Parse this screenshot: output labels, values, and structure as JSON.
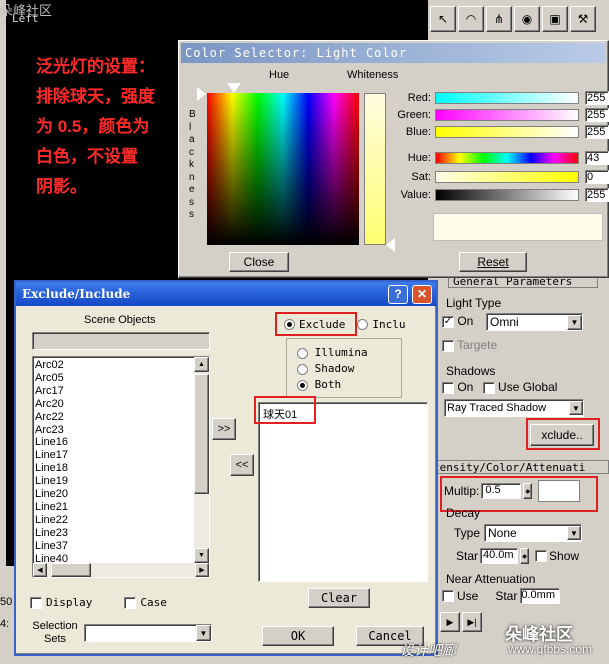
{
  "viewport": {
    "label": "Left",
    "watermark_top": "朵峰社区",
    "note_lines": [
      "泛光灯的设置：",
      "排除球天，强度",
      "为 0.5，颜色为",
      "白色，不设置",
      "阴影。"
    ]
  },
  "toolbar": {
    "icons": [
      "select-icon",
      "arc-icon",
      "hierarchy-icon",
      "motion-icon",
      "display-icon",
      "utilities-icon"
    ]
  },
  "color_selector": {
    "title": "Color Selector: Light Color",
    "hue_label": "Hue",
    "whiteness_label": "Whiteness",
    "blackness_label": "B l a c k n e s s",
    "rows": [
      {
        "label": "Red:",
        "value": "255"
      },
      {
        "label": "Green:",
        "value": "255"
      },
      {
        "label": "Blue:",
        "value": "255"
      },
      {
        "label": "Hue:",
        "value": "43"
      },
      {
        "label": "Sat:",
        "value": "0"
      },
      {
        "label": "Value:",
        "value": "255"
      }
    ],
    "close": "Close",
    "reset": "Reset"
  },
  "panel": {
    "general_params": "General Parameters",
    "light_type": "Light Type",
    "on": "On",
    "type_value": "Omni",
    "targeted": "Targete",
    "shadows": "Shadows",
    "shadow_on": "On",
    "use_global": "Use Global",
    "shadow_type": "Ray Traced Shadow",
    "exclude_btn": "xclude..",
    "intensity": "tensity/Color/Attenuati",
    "multiplier": "Multip:",
    "multiplier_value": "0.5",
    "decay": "Decay",
    "decay_type": "Type",
    "decay_value": "None",
    "start": "Star",
    "start_value": "40.0m",
    "show": "Show",
    "near_atten": "Near Attenuation",
    "use": "Use",
    "near_start": "Star",
    "near_start_value": "0.0mm"
  },
  "exclude": {
    "title": "Exclude/Include",
    "scene_objects": "Scene Objects",
    "objects": [
      "Arc02",
      "Arc05",
      "Arc17",
      "Arc20",
      "Arc22",
      "Arc23",
      "Line16",
      "Line17",
      "Line18",
      "Line19",
      "Line20",
      "Line21",
      "Line22",
      "Line23",
      "Line37",
      "Line40"
    ],
    "exclude": "Exclude",
    "include": "Inclu",
    "illumination": "Illumina",
    "shadow": "Shadow",
    "both": "Both",
    "excluded": [
      "球天01"
    ],
    "add": ">>",
    "remove": "<<",
    "display": "Display",
    "case": "Case",
    "selection_sets": "Selection Sets",
    "clear": "Clear",
    "ok": "OK",
    "cancel": "Cancel"
  },
  "left_strip": [
    "50",
    "4:"
  ],
  "watermark": {
    "site": "设计吧廊",
    "brand": "朵峰社区",
    "url": "www.qfbbs.com"
  }
}
